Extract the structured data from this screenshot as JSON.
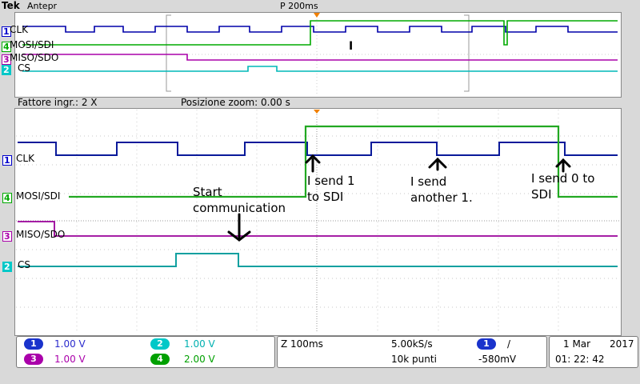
{
  "header": {
    "brand": "Tek",
    "mode": "Antepr",
    "trigger_pos": "P 200ms"
  },
  "zoom_info": {
    "factor": "Fattore ingr.: 2 X",
    "position": "Posizione zoom: 0.00 s"
  },
  "channels": [
    {
      "num": "1",
      "name": "CLK",
      "color": "#0000cc"
    },
    {
      "num": "4",
      "name": "MOSI/SDI",
      "color": "#00aa00"
    },
    {
      "num": "3",
      "name": "MISO/SDO",
      "color": "#aa00aa"
    },
    {
      "num": "2",
      "name": "CS",
      "color": "#00bcbc"
    }
  ],
  "overview_marker": "I",
  "annotations": {
    "start": "Start\ncommunication",
    "send1": "I send 1\nto SDI",
    "send_another": "I send\nanother 1.",
    "send0": "I send 0 to\nSDI"
  },
  "bottom": {
    "ch_volts": [
      {
        "num": "1",
        "value": "1.00 V",
        "pill": "#1a33cc",
        "text": "#2a2acc"
      },
      {
        "num": "2",
        "value": "1.00 V",
        "pill": "#00c8c8",
        "text": "#00b0b0"
      },
      {
        "num": "3",
        "value": "1.00 V",
        "pill": "#aa00aa",
        "text": "#aa00aa"
      },
      {
        "num": "4",
        "value": "2.00 V",
        "pill": "#00a000",
        "text": "#00a000"
      }
    ],
    "zoom": "Z 100ms",
    "sample_rate": "5.00kS/s",
    "points": "10k punti",
    "trig_channel": "1",
    "trig_slope": "/",
    "trig_level": "-580mV",
    "date": "1 Mar",
    "year": "2017",
    "time": "01: 22: 42"
  }
}
